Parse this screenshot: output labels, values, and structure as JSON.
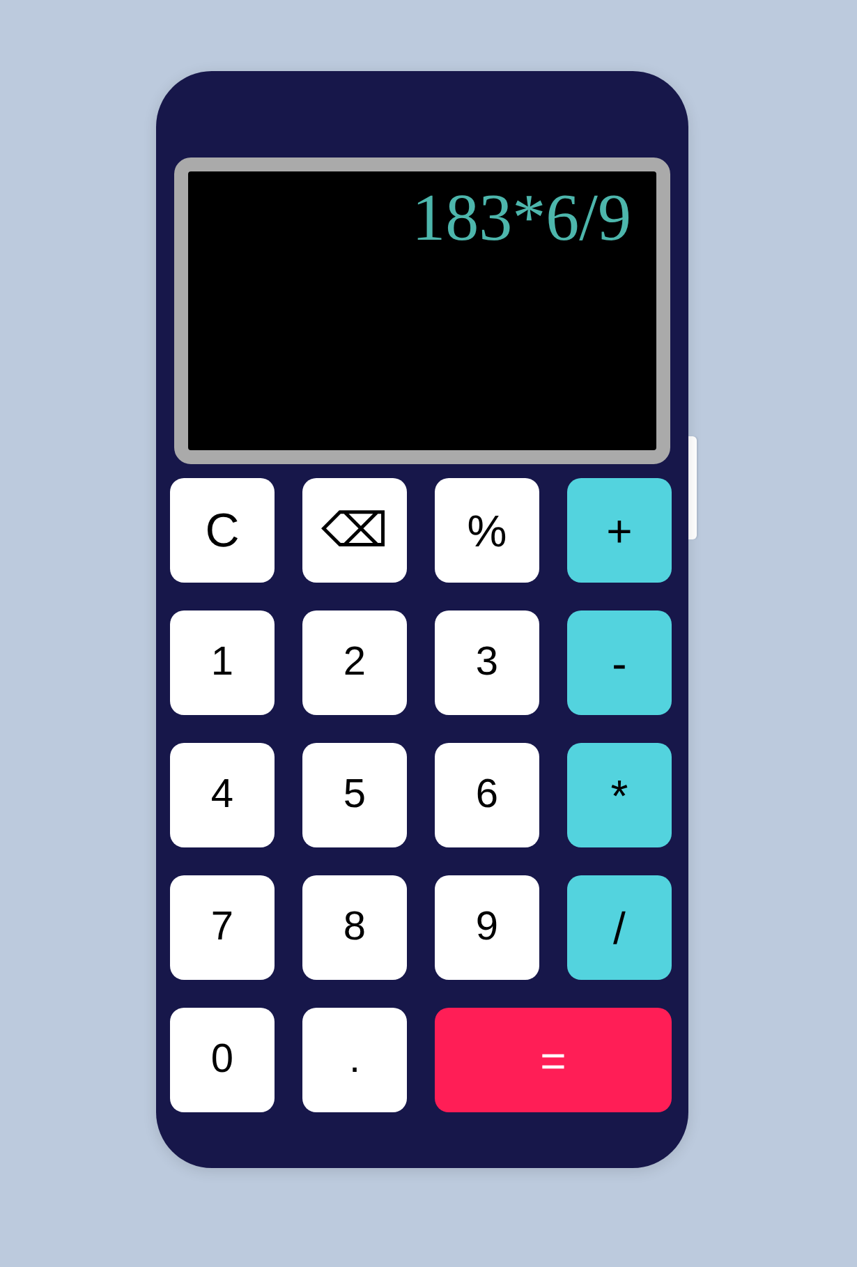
{
  "display": {
    "expression": "183*6/9"
  },
  "keys": [
    {
      "label": "C",
      "kind": "clear"
    },
    {
      "label": "⌫",
      "kind": "backspace"
    },
    {
      "label": "%",
      "kind": "function"
    },
    {
      "label": "+",
      "kind": "operator"
    },
    {
      "label": "1",
      "kind": "digit"
    },
    {
      "label": "2",
      "kind": "digit"
    },
    {
      "label": "3",
      "kind": "digit"
    },
    {
      "label": "-",
      "kind": "operator"
    },
    {
      "label": "4",
      "kind": "digit"
    },
    {
      "label": "5",
      "kind": "digit"
    },
    {
      "label": "6",
      "kind": "digit"
    },
    {
      "label": "*",
      "kind": "operator"
    },
    {
      "label": "7",
      "kind": "digit"
    },
    {
      "label": "8",
      "kind": "digit"
    },
    {
      "label": "9",
      "kind": "digit"
    },
    {
      "label": "/",
      "kind": "operator"
    },
    {
      "label": "0",
      "kind": "digit"
    },
    {
      "label": ".",
      "kind": "digit"
    },
    {
      "label": "=",
      "kind": "equals"
    }
  ]
}
